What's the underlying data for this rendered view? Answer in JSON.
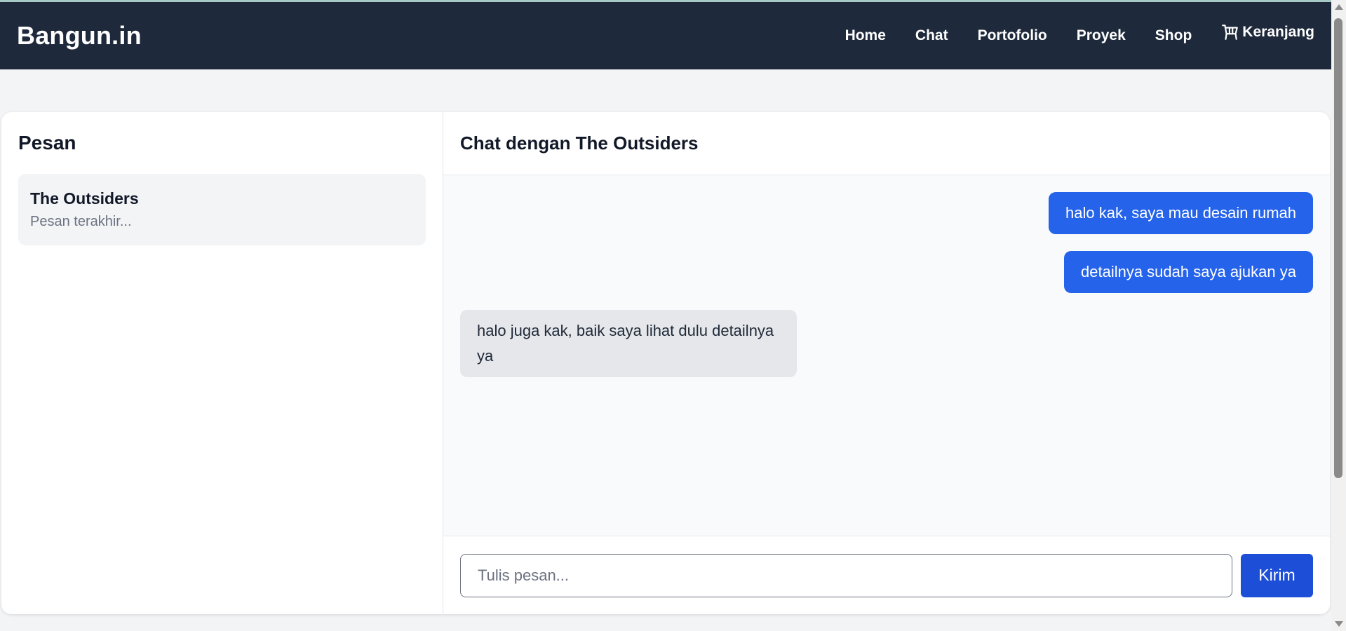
{
  "navbar": {
    "brand": "Bangun.in",
    "links": [
      "Home",
      "Chat",
      "Portofolio",
      "Proyek",
      "Shop"
    ],
    "cart_label": "Keranjang",
    "cart_icon": "shopping-cart-icon"
  },
  "sidebar": {
    "title": "Pesan",
    "conversations": [
      {
        "name": "The Outsiders",
        "preview": "Pesan terakhir..."
      }
    ]
  },
  "chat": {
    "title": "Chat dengan The Outsiders",
    "messages": [
      {
        "direction": "out",
        "text": "halo kak, saya mau desain rumah"
      },
      {
        "direction": "out",
        "text": "detailnya sudah saya ajukan ya"
      },
      {
        "direction": "in",
        "text": "halo juga kak, baik saya lihat dulu detailnya ya"
      }
    ],
    "input_placeholder": "Tulis pesan...",
    "input_value": "",
    "send_label": "Kirim"
  },
  "colors": {
    "navbar_bg": "#1e293b",
    "outgoing_bubble": "#2563eb",
    "incoming_bubble": "#e5e7eb",
    "send_button": "#1d4ed8"
  }
}
